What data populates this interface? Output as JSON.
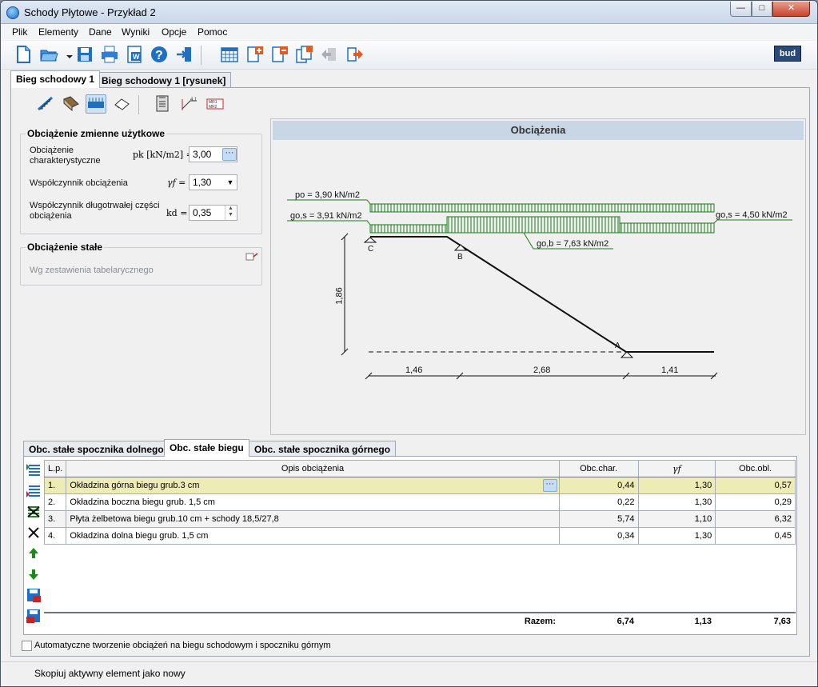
{
  "window": {
    "title": "Schody Płytowe - Przykład 2",
    "btn_min": "—",
    "btn_max": "□",
    "btn_close": "✕"
  },
  "menu": [
    "Plik",
    "Elementy",
    "Dane",
    "Wyniki",
    "Opcje",
    "Pomoc"
  ],
  "toolbar": {
    "icons": [
      "new-document-icon",
      "open-folder-icon",
      "save-icon",
      "print-icon",
      "word-export-icon",
      "help-icon",
      "exit-icon",
      "calendar-table-icon",
      "add-element-icon",
      "remove-element-icon",
      "copy-element-icon",
      "move-left-icon",
      "move-right-icon"
    ],
    "logo": "bud"
  },
  "tabs_top": [
    "Bieg schodowy 1",
    "Bieg schodowy 1  [rysunek]"
  ],
  "sub_toolbar": {
    "icons": [
      "stair-geometry-icon",
      "material-icon",
      "loads-icon",
      "eraser-icon",
      "clipboard-icon",
      "dimension-icon",
      "reinforcement-icon"
    ]
  },
  "variable_load": {
    "title": "Obciążenie zmienne użytkowe",
    "char_label": "Obciążenie\ncharakterystyczne",
    "char_symbol": "pk [kN/m2] =",
    "char_value": "3,00",
    "gamma_label": "Współczynnik obciążenia",
    "gamma_symbol": "γf =",
    "gamma_value": "1,30",
    "kd_label": "Współczynnik długotrwałej części\nobciążenia",
    "kd_symbol": "kd =",
    "kd_value": "0,35"
  },
  "permanent_load": {
    "title": "Obciążenie stałe",
    "placeholder": "Wg zestawienia tabelarycznego"
  },
  "drawing": {
    "header": "Obciążenia",
    "po_label": "po = 3,90 kN/m2",
    "gos_left_label": "go,s = 3,91 kN/m2",
    "gos_right_label": "go,s = 4,50 kN/m2",
    "gob_label": "go,b = 7,63 kN/m2",
    "support_c": "C",
    "support_b": "B",
    "support_a": "A",
    "height": "1,86",
    "dim1": "1,46",
    "dim2": "2,68",
    "dim3": "1,41"
  },
  "tabs_bottom": [
    "Obc. stałe spocznika dolnego",
    "Obc. stałe biegu",
    "Obc. stałe spocznika górnego"
  ],
  "side_buttons": [
    "insert-row-above-icon",
    "insert-row-below-icon",
    "delete-row-icon",
    "clear-icon",
    "move-up-icon",
    "move-down-icon",
    "save-table-icon",
    "load-table-icon"
  ],
  "table": {
    "columns": [
      "L.p.",
      "Opis obciążenia",
      "Obc.char.",
      "γf",
      "Obc.obl."
    ],
    "rows": [
      {
        "lp": "1.",
        "desc": "Okładzina górna biegu grub.3 cm",
        "char": "0,44",
        "gf": "1,30",
        "obl": "0,57"
      },
      {
        "lp": "2.",
        "desc": "Okładzina boczna biegu grub. 1,5 cm",
        "char": "0,22",
        "gf": "1,30",
        "obl": "0,29"
      },
      {
        "lp": "3.",
        "desc": "Płyta żelbetowa biegu grub.10 cm + schody 18,5/27,8",
        "char": "5,74",
        "gf": "1,10",
        "obl": "6,32"
      },
      {
        "lp": "4.",
        "desc": "Okładzina dolna biegu grub. 1,5 cm",
        "char": "0,34",
        "gf": "1,30",
        "obl": "0,45"
      }
    ],
    "sum_label": "Razem:",
    "sum_char": "6,74",
    "sum_gf": "1,13",
    "sum_obl": "7,63"
  },
  "auto_checkbox_label": "Automatyczne tworzenie obciążeń na biegu schodowym i spoczniku górnym",
  "status": "Skopiuj aktywny element jako nowy"
}
